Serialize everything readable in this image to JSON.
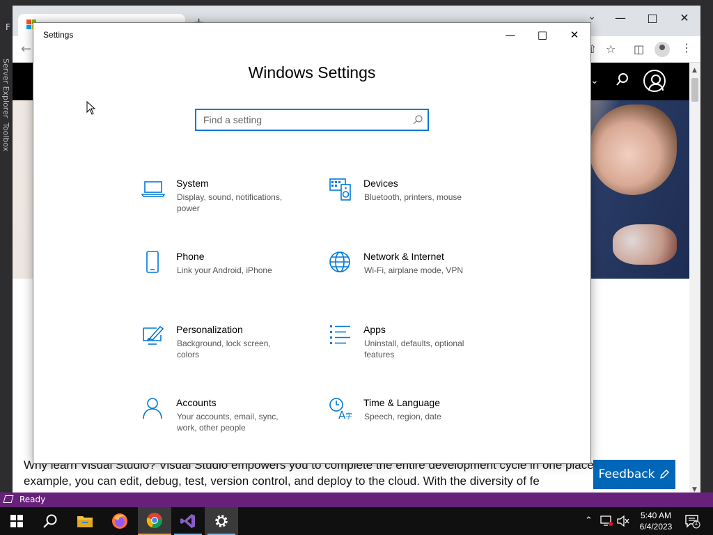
{
  "vs": {
    "rail_server_explorer": "Server Explorer",
    "rail_toolbox": "Toolbox",
    "menu_letter": "F",
    "status_text": "Ready",
    "status_color": "#68217a"
  },
  "browser": {
    "tab_icon": "microsoft-logo",
    "new_tab": "+",
    "page_feedback_label": "Feedback",
    "body_fragment_to": "to",
    "body_paragraph": "Why learn Visual Studio? Visual Studio empowers you to complete the entire development cycle in one place. For example, you can edit, debug, test, version control, and deploy to the cloud. With the diversity of fe"
  },
  "settings": {
    "window_title": "Settings",
    "heading": "Windows Settings",
    "search_placeholder": "Find a setting",
    "accent": "#0078d7",
    "tiles": [
      {
        "title": "System",
        "subtitle": "Display, sound, notifications, power",
        "icon": "laptop-icon"
      },
      {
        "title": "Devices",
        "subtitle": "Bluetooth, printers, mouse",
        "icon": "devices-icon"
      },
      {
        "title": "Phone",
        "subtitle": "Link your Android, iPhone",
        "icon": "phone-icon"
      },
      {
        "title": "Network & Internet",
        "subtitle": "Wi-Fi, airplane mode, VPN",
        "icon": "globe-icon"
      },
      {
        "title": "Personalization",
        "subtitle": "Background, lock screen, colors",
        "icon": "paint-icon"
      },
      {
        "title": "Apps",
        "subtitle": "Uninstall, defaults, optional features",
        "icon": "apps-list-icon"
      },
      {
        "title": "Accounts",
        "subtitle": "Your accounts, email, sync, work, other people",
        "icon": "person-icon"
      },
      {
        "title": "Time & Language",
        "subtitle": "Speech, region, date",
        "icon": "time-language-icon"
      }
    ]
  },
  "taskbar": {
    "items": [
      "start",
      "search",
      "file-explorer",
      "firefox",
      "chrome",
      "visual-studio",
      "settings"
    ],
    "time": "5:40 AM",
    "date": "6/4/2023",
    "notification_count": "1"
  }
}
